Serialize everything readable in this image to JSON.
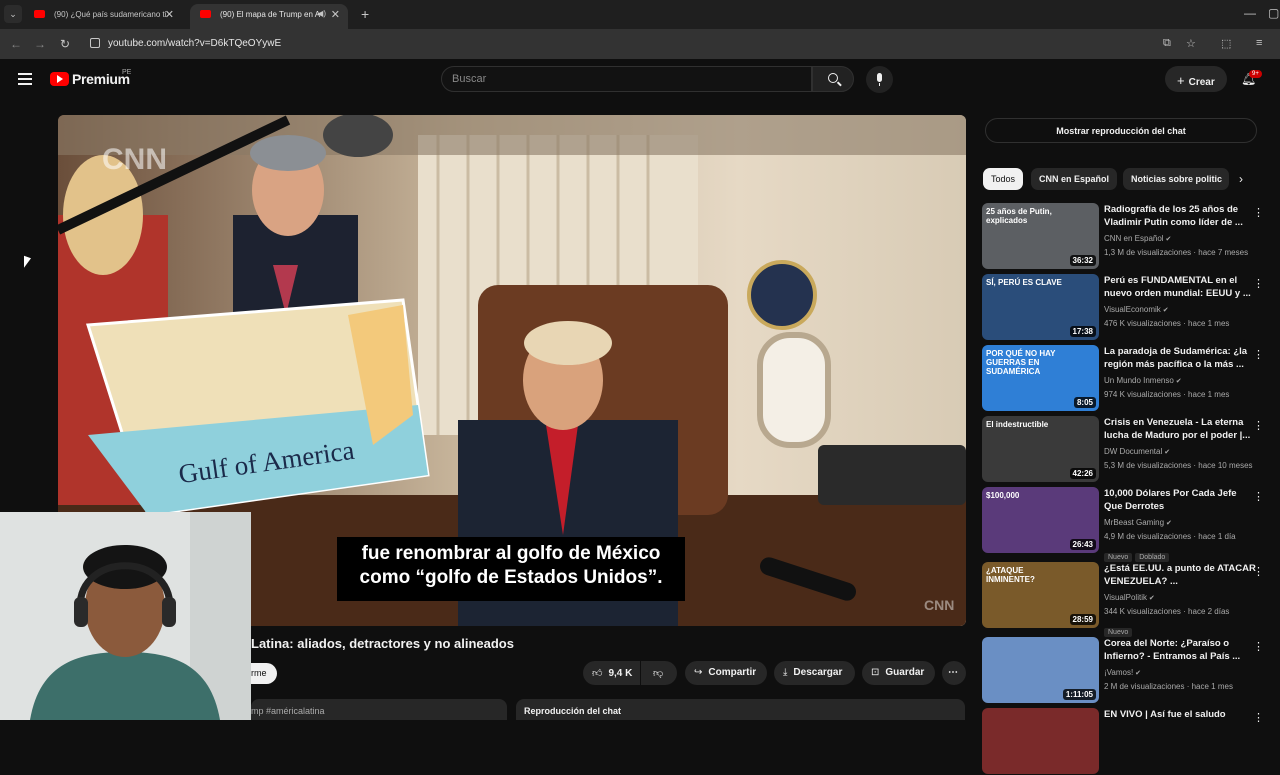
{
  "browser": {
    "tabs": [
      {
        "title": "(90) ¿Qué país sudamericano ti",
        "active": false
      },
      {
        "title": "(90) El mapa de Trump en A",
        "active": true
      }
    ],
    "url": "youtube.com/watch?v=D6kTQeOYywE"
  },
  "header": {
    "logo": "Premium",
    "country": "PE",
    "search_placeholder": "Buscar",
    "create_label": "Crear",
    "notifications": "9+"
  },
  "player": {
    "caption_line1": "fue renombrar al golfo de México",
    "caption_line2": "como “golfo de Estados Unidos”.",
    "watermark": "CNN",
    "watermark_small": "CNN",
    "map_text": "Gulf of America"
  },
  "video": {
    "title": "Latina: aliados, detractores y no alineados",
    "join_label": "rme",
    "like_count": "9,4 K",
    "share_label": "Compartir",
    "download_label": "Descargar",
    "save_label": "Guardar",
    "description_snippet": "mp #américalatina",
    "chat_replay_label": "Reproducción del chat"
  },
  "sidebar": {
    "chat_replay_button": "Mostrar reproducción del chat",
    "chips": [
      "Todos",
      "CNN en Español",
      "Noticias sobre politic"
    ],
    "recommendations": [
      {
        "title": "Radiografía de los 25 años de Vladimir Putin como líder de ...",
        "channel": "CNN en Español",
        "meta": "1,3 M de visualizaciones · hace 7 meses",
        "duration": "36:32",
        "badges": [],
        "thumb_text": "25 años de Putin, explicados"
      },
      {
        "title": "Perú es FUNDAMENTAL en el nuevo orden mundial: EEUU y ...",
        "channel": "VisualEconomik",
        "meta": "476 K visualizaciones · hace 1 mes",
        "duration": "17:38",
        "badges": [],
        "thumb_text": "SÍ, PERÚ ES CLAVE"
      },
      {
        "title": "La paradoja de Sudamérica: ¿la región más pacífica o la más ...",
        "channel": "Un Mundo Inmenso",
        "meta": "974 K visualizaciones · hace 1 mes",
        "duration": "8:05",
        "badges": [],
        "thumb_text": "POR QUÉ NO HAY GUERRAS EN SUDAMÉRICA"
      },
      {
        "title": "Crisis en Venezuela - La eterna lucha de Maduro por el poder |...",
        "channel": "DW Documental",
        "meta": "5,3 M de visualizaciones · hace 10 meses",
        "duration": "42:26",
        "badges": [],
        "thumb_text": "El indestructible"
      },
      {
        "title": "10,000 Dólares Por Cada Jefe Que Derrotes",
        "channel": "MrBeast Gaming",
        "meta": "4,9 M de visualizaciones · hace 1 día",
        "duration": "26:43",
        "badges": [
          "Nuevo",
          "Doblado"
        ],
        "thumb_text": "$100,000"
      },
      {
        "title": "¿Está EE.UU. a punto de ATACAR VENEZUELA? ...",
        "channel": "VisualPolitik",
        "meta": "344 K visualizaciones · hace 2 días",
        "duration": "28:59",
        "badges": [
          "Nuevo"
        ],
        "thumb_text": "¿ATAQUE INMINENTE?"
      },
      {
        "title": "Corea del Norte: ¿Paraíso o Infierno? - Entramos al País ...",
        "channel": "¡Vamos!",
        "meta": "2 M de visualizaciones · hace 1 mes",
        "duration": "1:11:05",
        "badges": [],
        "thumb_text": ""
      },
      {
        "title": "EN VIVO | Así fue el saludo",
        "channel": "",
        "meta": "",
        "duration": "",
        "badges": [],
        "thumb_text": ""
      }
    ]
  }
}
